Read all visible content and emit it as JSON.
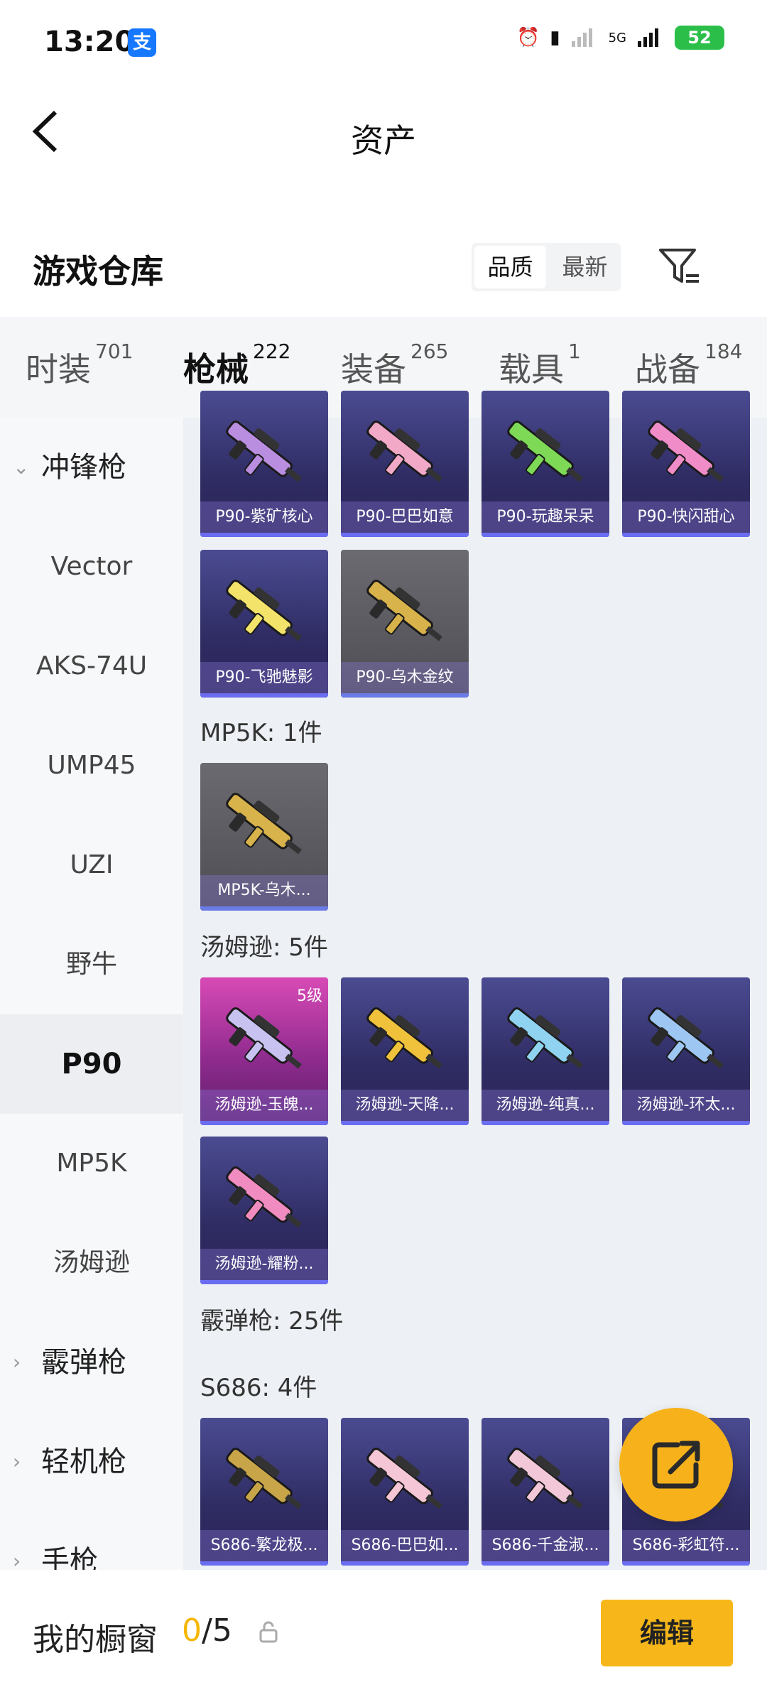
{
  "status_bar": {
    "time": "13:20",
    "alipay_glyph": "支",
    "signal_label": "5G",
    "battery": "52"
  },
  "header": {
    "title": "资产"
  },
  "warehouse": {
    "title": "游戏仓库",
    "sort_options": [
      "品质",
      "最新"
    ],
    "active_sort": "品质"
  },
  "tabs": [
    {
      "label": "时装",
      "count": "701"
    },
    {
      "label": "枪械",
      "count": "222"
    },
    {
      "label": "装备",
      "count": "265"
    },
    {
      "label": "载具",
      "count": "1"
    },
    {
      "label": "战备",
      "count": "184"
    }
  ],
  "sidebar": {
    "items": [
      {
        "label": "冲锋枪",
        "type": "group",
        "chevron": "⌄"
      },
      {
        "label": "Vector"
      },
      {
        "label": "AKS-74U"
      },
      {
        "label": "UMP45"
      },
      {
        "label": "UZI"
      },
      {
        "label": "野牛"
      },
      {
        "label": "P90",
        "active": true
      },
      {
        "label": "MP5K"
      },
      {
        "label": "汤姆逊"
      },
      {
        "label": "霰弹枪",
        "type": "group",
        "chevron": "›"
      },
      {
        "label": "轻机枪",
        "type": "group",
        "chevron": "›"
      },
      {
        "label": "手枪",
        "type": "group",
        "chevron": "›"
      }
    ]
  },
  "content": {
    "p90_items": [
      {
        "name": "P90-紫矿核心",
        "gun_color": "#b98de0"
      },
      {
        "name": "P90-巴巴如意",
        "gun_color": "#f2a9c8"
      },
      {
        "name": "P90-玩趣呆呆",
        "gun_color": "#7ed957"
      },
      {
        "name": "P90-快闪甜心",
        "gun_color": "#f08cc8"
      },
      {
        "name": "P90-飞驰魅影",
        "gun_color": "#f3e36a"
      },
      {
        "name": "P90-乌木金纹",
        "gun_color": "#d8b24a"
      }
    ],
    "mp5k_section": "MP5K: 1件",
    "mp5k_items": [
      {
        "name": "MP5K-乌木...",
        "gun_color": "#d8b24a"
      }
    ],
    "thompson_section": "汤姆逊: 5件",
    "thompson_items": [
      {
        "name": "汤姆逊-玉魄...",
        "gun_color": "#c7c2f0",
        "badge": "5级"
      },
      {
        "name": "汤姆逊-天降...",
        "gun_color": "#f0c23c"
      },
      {
        "name": "汤姆逊-纯真...",
        "gun_color": "#8fd3f0"
      },
      {
        "name": "汤姆逊-环太...",
        "gun_color": "#9ec6f2"
      },
      {
        "name": "汤姆逊-耀粉...",
        "gun_color": "#f08cc0"
      }
    ],
    "shotgun_section": "霰弹枪: 25件",
    "s686_section": "S686: 4件",
    "s686_items": [
      {
        "name": "S686-繁龙极...",
        "gun_color": "#c9a54a"
      },
      {
        "name": "S686-巴巴如...",
        "gun_color": "#f5c6d6"
      },
      {
        "name": "S686-千金淑...",
        "gun_color": "#f2c8d8"
      },
      {
        "name": "S686-彩虹符...",
        "gun_color": "#9ad6f0"
      }
    ]
  },
  "bottom_bar": {
    "label": "我的橱窗",
    "count_current": "0",
    "count_total": "/5",
    "edit_label": "编辑"
  },
  "colors": {
    "accent": "#f5b600",
    "card_purple": "#2f2c63",
    "card_gray": "#55555b"
  }
}
